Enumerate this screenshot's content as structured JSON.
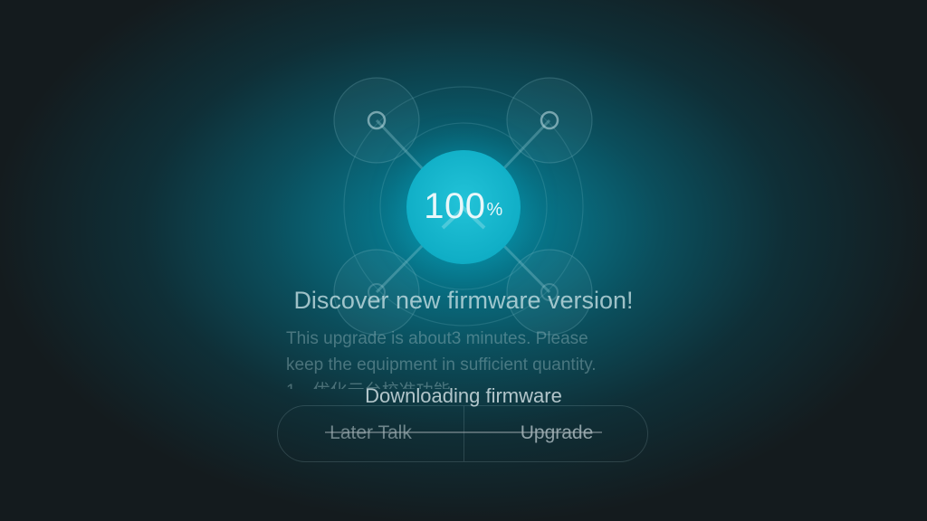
{
  "progress": {
    "value": "100",
    "unit": "%"
  },
  "dialog": {
    "title": "Discover new firmware version!",
    "body_lines": [
      "This upgrade is about3 minutes. Please",
      "keep the equipment in sufficient quantity.",
      "1、优化云台校准功能"
    ]
  },
  "status": {
    "text": "Downloading firmware"
  },
  "buttons": {
    "later": "Later Talk",
    "upgrade": "Upgrade"
  },
  "colors": {
    "accent": "#10aec6",
    "background_center": "#0a8fa6",
    "background_edge": "#141b1e"
  },
  "icons": {
    "drone_graphic": "drone-icon",
    "upgrade_arrow": "chevron-up-icon"
  }
}
